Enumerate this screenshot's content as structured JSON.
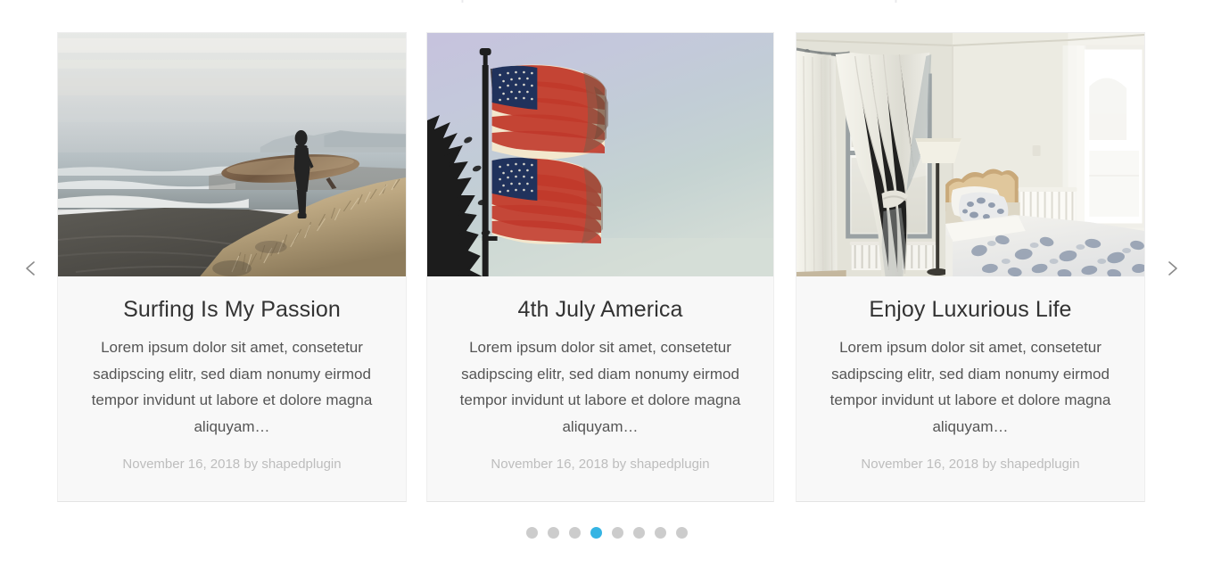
{
  "page": {
    "background": "#ffffff",
    "cut_off_text_top": "p"
  },
  "carousel": {
    "name": "post-carousel",
    "nav": {
      "prev_icon": "chevron-left-icon",
      "next_icon": "chevron-right-icon",
      "prev_label": "Previous",
      "next_label": "Next",
      "arrow_color": "#888888"
    },
    "pagination": {
      "total_dots": 8,
      "active_index": 3,
      "active_color": "#35b4e3",
      "inactive_color": "#cccccc",
      "dots": [
        "1",
        "2",
        "3",
        "4",
        "5",
        "6",
        "7",
        "8"
      ]
    },
    "slides": [
      {
        "title": "Surfing Is My Passion",
        "excerpt": "Lorem ipsum dolor sit amet, consetetur sadipscing elitr, sed diam nonumy eirmod tempor invidunt ut labore et dolore magna aliquyam…",
        "date": "November 16, 2018",
        "by": "by",
        "author": "shapedplugin",
        "image_name": "surfer-on-beach-photo",
        "image_alt": "Silhouette of a surfer holding a longboard on a misty beach dune at dawn"
      },
      {
        "title": "4th July America",
        "excerpt": "Lorem ipsum dolor sit amet, consetetur sadipscing elitr, sed diam nonumy eirmod tempor invidunt ut labore et dolore magna aliquyam…",
        "date": "November 16, 2018",
        "by": "by",
        "author": "shapedplugin",
        "image_name": "american-flags-photo",
        "image_alt": "Two American flags waving on a flagpole against a pastel evening sky"
      },
      {
        "title": "Enjoy Luxurious Life",
        "excerpt": "Lorem ipsum dolor sit amet, consetetur sadipscing elitr, sed diam nonumy eirmod tempor invidunt ut labore et dolore magna aliquyam…",
        "date": "November 16, 2018",
        "by": "by",
        "author": "shapedplugin",
        "image_name": "bright-bedroom-photo",
        "image_alt": "Sunlit bedroom with white curtains, floor lamp and blue floral bedspread"
      }
    ],
    "style": {
      "card_background": "#f8f8f8",
      "card_border": "#eeeeee",
      "title_color": "#333333",
      "excerpt_color": "#555555",
      "meta_color": "#bdbdbd"
    }
  }
}
